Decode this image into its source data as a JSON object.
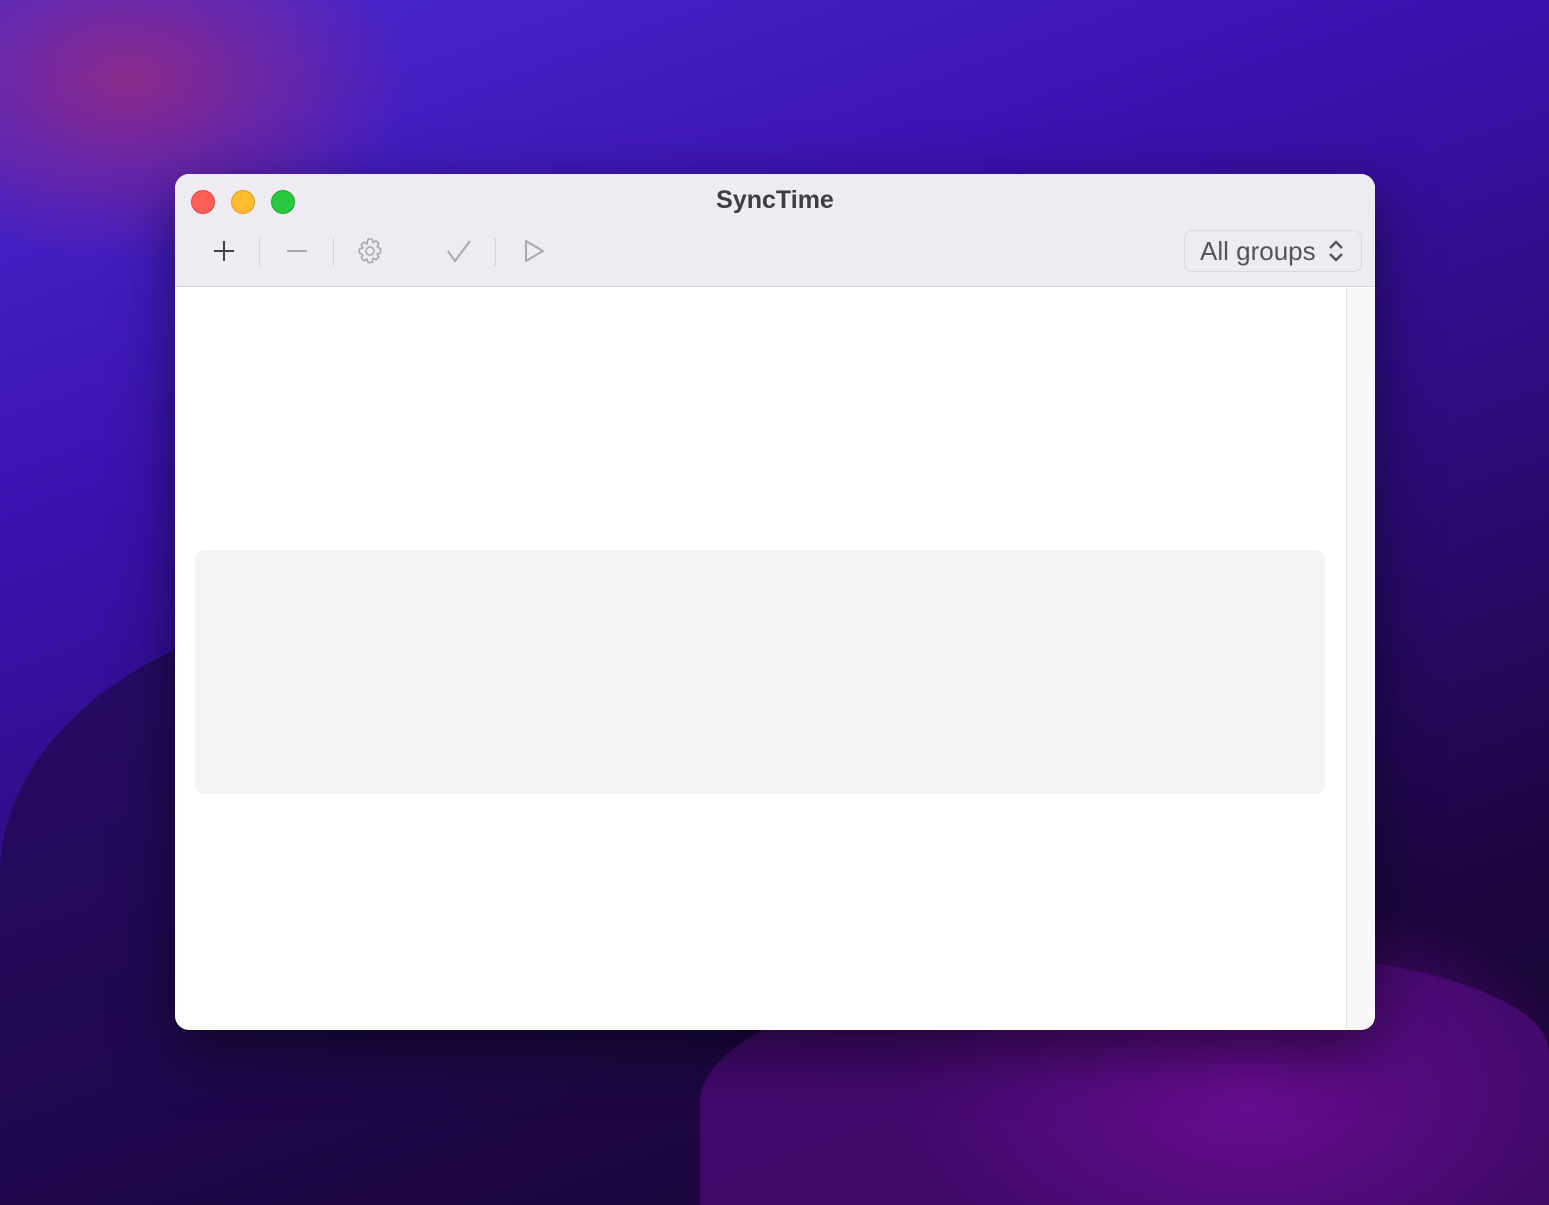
{
  "window": {
    "title": "SyncTime"
  },
  "toolbar": {
    "add": "add",
    "remove": "remove",
    "settings": "settings",
    "check": "check",
    "run": "run"
  },
  "group_picker": {
    "selected": "All groups"
  }
}
